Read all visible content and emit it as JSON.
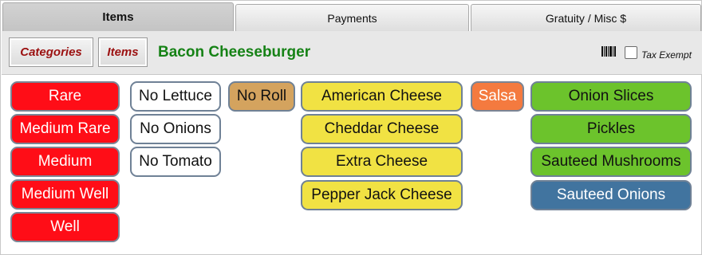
{
  "tabs": [
    {
      "label": "Items",
      "active": true
    },
    {
      "label": "Payments",
      "active": false
    },
    {
      "label": "Gratuity / Misc $",
      "active": false
    }
  ],
  "header": {
    "categories_label": "Categories",
    "items_label": "Items",
    "item_title": "Bacon Cheeseburger",
    "tax_exempt_label": "Tax Exempt",
    "tax_exempt_checked": false
  },
  "colors": {
    "doneness": "#ff0d17",
    "remove": "#ffffff",
    "no_roll": "#d4a35e",
    "cheese": "#f1e243",
    "salsa": "#f47a3f",
    "toppings": "#6cc32c",
    "selected": "#41749f",
    "title": "#168216",
    "nav_label": "#9b1010"
  },
  "options": {
    "doneness": [
      "Rare",
      "Medium Rare",
      "Medium",
      "Medium Well",
      "Well"
    ],
    "remove": [
      "No Lettuce",
      "No Onions",
      "No Tomato"
    ],
    "roll": [
      "No Roll"
    ],
    "cheese": [
      "American Cheese",
      "Cheddar Cheese",
      "Extra Cheese",
      "Pepper Jack Cheese"
    ],
    "sauce": [
      "Salsa"
    ],
    "toppings": [
      "Onion Slices",
      "Pickles",
      "Sauteed Mushrooms",
      "Sauteed Onions"
    ]
  }
}
